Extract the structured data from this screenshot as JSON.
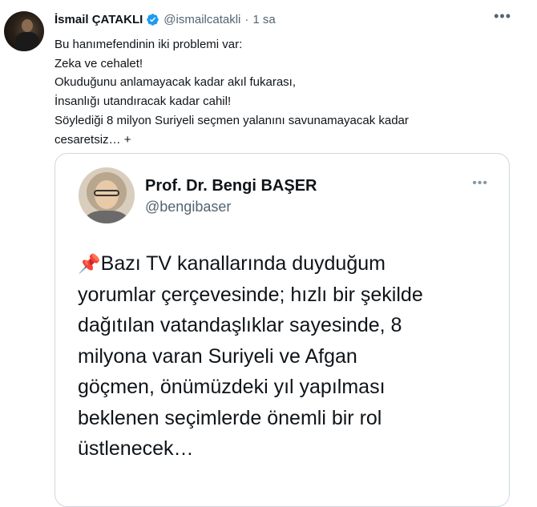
{
  "tweet": {
    "author_name": "İsmail ÇATAKLI",
    "handle": "@ismailcatakli",
    "separator": "·",
    "time": "1 sa",
    "text": "Bu hanımefendinin iki problemi var:\nZeka ve cehalet!\nOkuduğunu anlamayacak kadar akıl fukarası,\nİnsanlığı utandıracak kadar cahil!\nSöylediği 8 milyon Suriyeli seçmen yalanını savunamayacak kadar\ncesaretsiz… +",
    "more_icon": "more-horizontal-icon",
    "verified_icon": "verified-badge-icon",
    "verified_color": "#1d9bf0"
  },
  "quoted": {
    "author_name": "Prof. Dr. Bengi BAŞER",
    "handle": "@bengibaser",
    "pin_icon": "📌",
    "text": "Bazı TV kanallarında duyduğum\nyorumlar çerçevesinde; hızlı bir şekilde\ndağıtılan vatandaşlıklar sayesinde, 8\nmilyona varan Suriyeli ve Afgan\ngöçmen, önümüzdeki yıl yapılması\nbeklenen seçimlerde önemli bir rol\nüstlenecek…",
    "more_icon": "more-horizontal-icon"
  }
}
